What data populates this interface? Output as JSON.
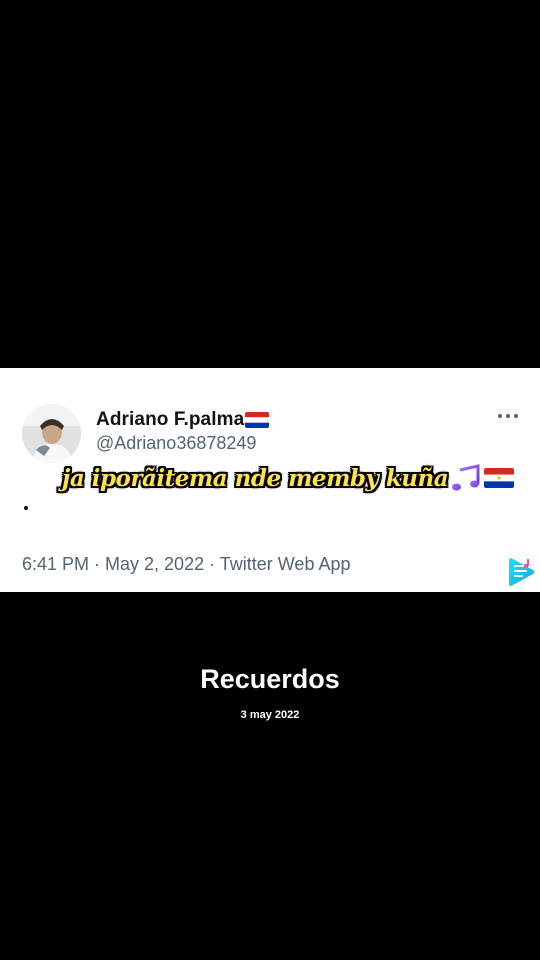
{
  "tweet": {
    "display_name": "Adriano F.palma",
    "handle": "@Adriano36878249",
    "caption": "ja iporãitema nde memby kuña",
    "body_text": ".",
    "meta": "6:41 PM · May 2, 2022 · Twitter Web App",
    "icons": {
      "more": "more-options-icon",
      "flag": "paraguay-flag-icon",
      "music": "music-note-icon",
      "play": "play-icon"
    },
    "colors": {
      "card_background": "#ffffff",
      "name_color": "#0f1419",
      "secondary_text": "#536471",
      "caption_color": "#ffe34d"
    }
  },
  "memory": {
    "title": "Recuerdos",
    "date": "3 may 2022"
  },
  "page": {
    "background": "#000000"
  }
}
